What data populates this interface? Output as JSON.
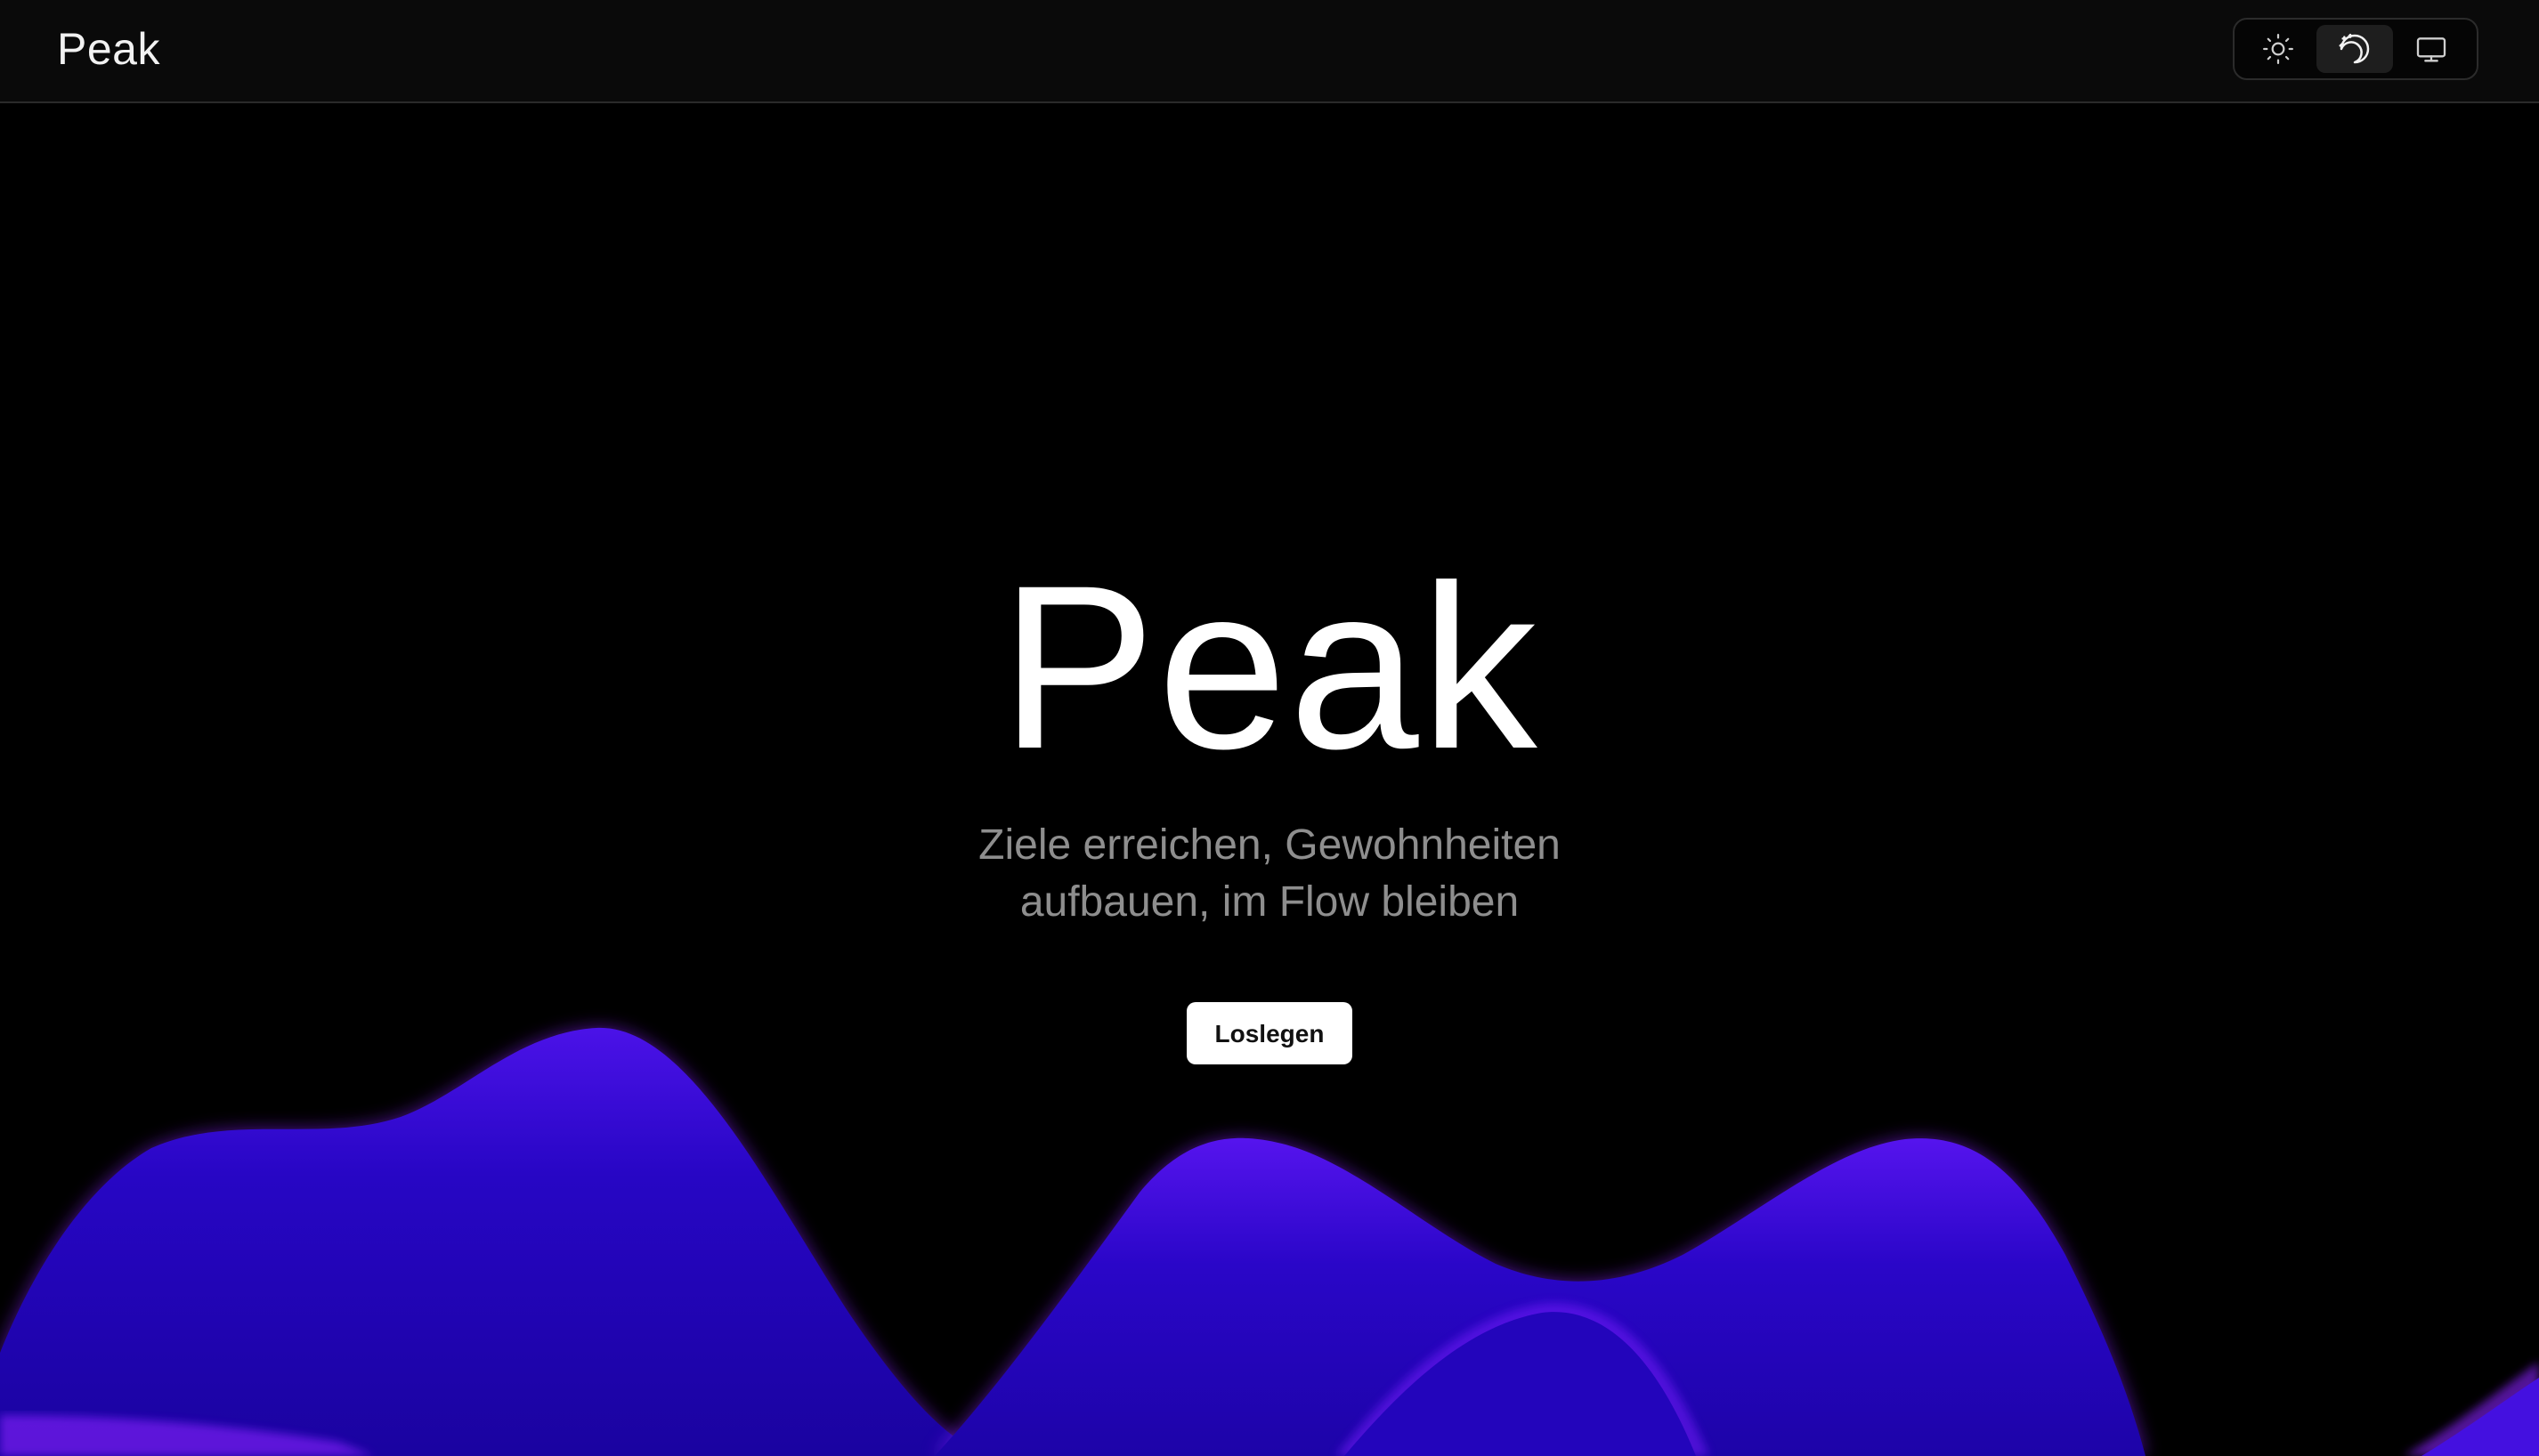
{
  "header": {
    "brand": "Peak",
    "theme_options": [
      {
        "icon": "sun-icon",
        "label": "Light"
      },
      {
        "icon": "moon-stars-icon",
        "label": "Dark"
      },
      {
        "icon": "monitor-icon",
        "label": "System"
      }
    ],
    "active_theme": "Dark"
  },
  "hero": {
    "title": "Peak",
    "subtitle": "Ziele erreichen, Gewohnheiten aufbauen, im Flow bleiben",
    "cta_label": "Loslegen"
  },
  "colors": {
    "background": "#000000",
    "wave_primary": "#2a06c8",
    "wave_edge": "#7a1cff",
    "subtitle": "#8e8e8e"
  }
}
